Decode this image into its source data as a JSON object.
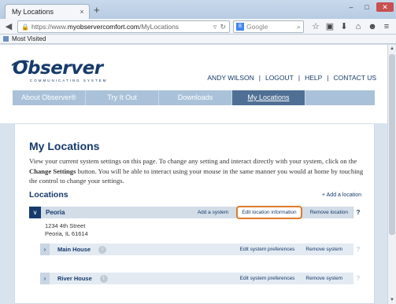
{
  "browser": {
    "tab_title": "My Locations",
    "tab_close": "×",
    "new_tab": "+",
    "window_controls": {
      "minimize": "–",
      "maximize": "□",
      "close": "✕"
    },
    "url_prefix": "https://www.",
    "url_domain": "myobservercomfort.com",
    "url_path": "/MyLocations",
    "search_placeholder": "Google",
    "bookmark_label": "Most Visited",
    "icons": [
      "back-icon",
      "lock-icon",
      "dropdown-icon",
      "reload-icon",
      "google-icon",
      "search-icon",
      "bookmark-star-icon",
      "clipboard-icon",
      "download-icon",
      "home-icon",
      "chat-icon",
      "menu-icon"
    ]
  },
  "site": {
    "logo_text": "Observer",
    "logo_sub": "COMMUNICATING SYSTEM",
    "user_links": [
      "ANDY WILSON",
      "LOGOUT",
      "HELP",
      "CONTACT US"
    ],
    "nav_tabs": [
      {
        "label": "About Observer®",
        "active": false
      },
      {
        "label": "Try It Out",
        "active": false
      },
      {
        "label": "Downloads",
        "active": false
      },
      {
        "label": "My Locations",
        "active": true
      }
    ]
  },
  "main": {
    "title": "My Locations",
    "intro_part1": "View your current system settings on this page. To change any setting and interact directly with your system, click on the ",
    "intro_bold": "Change Settings",
    "intro_part2": " button. You will be able to interact using your mouse in the same manner you would at home by touching the control to change your settings.",
    "locations_heading": "Locations",
    "add_location": "+ Add a location",
    "location": {
      "name": "Peoria",
      "toggle": "∨",
      "actions": {
        "add_system": "Add a system",
        "edit_location": "Edit location information",
        "remove_location": "Remove location",
        "help": "?"
      },
      "address_line1": "1234 4th Street",
      "address_line2": "Peoria, IL 61614"
    },
    "systems": [
      {
        "name": "Main House",
        "edit": "Edit system preferences",
        "remove": "Remove system",
        "help": "?"
      },
      {
        "name": "River House",
        "edit": "Edit system preferences",
        "remove": "Remove system",
        "help": "?"
      }
    ]
  },
  "colors": {
    "brand_navy": "#163a6b",
    "nav_bar": "#a9c2d9",
    "nav_active": "#4f6f94",
    "highlight": "#e07a2b"
  }
}
